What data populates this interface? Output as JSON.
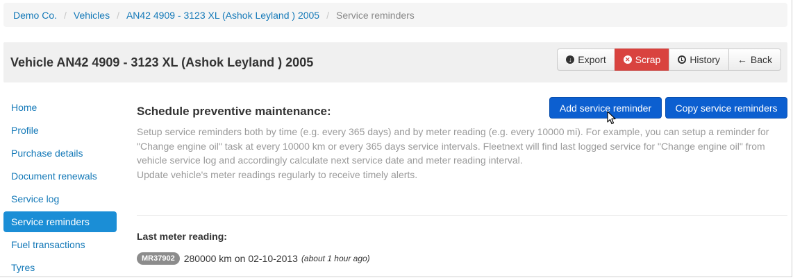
{
  "breadcrumb": {
    "items": [
      "Demo Co.",
      "Vehicles",
      "AN42 4909 - 3123 XL (Ashok Leyland ) 2005"
    ],
    "separator": "/",
    "current": "Service reminders"
  },
  "header": {
    "title": "Vehicle AN42 4909 - 3123 XL (Ashok Leyland ) 2005",
    "buttons": {
      "export": "Export",
      "scrap": "Scrap",
      "history": "History",
      "back": "Back"
    }
  },
  "sidebar": {
    "items": [
      {
        "label": "Home"
      },
      {
        "label": "Profile"
      },
      {
        "label": "Purchase details"
      },
      {
        "label": "Document renewals"
      },
      {
        "label": "Service log"
      },
      {
        "label": "Service reminders"
      },
      {
        "label": "Fuel transactions"
      },
      {
        "label": "Tyres"
      }
    ],
    "active_index": 5
  },
  "main": {
    "section_title": "Schedule preventive maintenance:",
    "add_button": "Add service reminder",
    "copy_button": "Copy service reminders",
    "help_paragraph": "Setup service reminders both by time (e.g. every 365 days) and by meter reading (e.g. every 10000 mi). For example, you can setup a reminder for \"Change engine oil\" task at every 10000 km or every 365 days service intervals. Fleetnext will find last logged service for \"Change engine oil\" from vehicle service log and accordingly calculate next service date and meter reading interval.",
    "help_note": "Update vehicle's meter readings regularly to receive timely alerts.",
    "meter": {
      "label": "Last meter reading:",
      "id": "MR37902",
      "reading": "280000 km on 02-10-2013",
      "ago": "(about 1 hour ago)"
    }
  },
  "colors": {
    "link": "#1479b8",
    "active_nav": "#1b8ed6",
    "primary": "#0c5fd0",
    "danger": "#d9433f",
    "badge": "#8c8c8c"
  }
}
